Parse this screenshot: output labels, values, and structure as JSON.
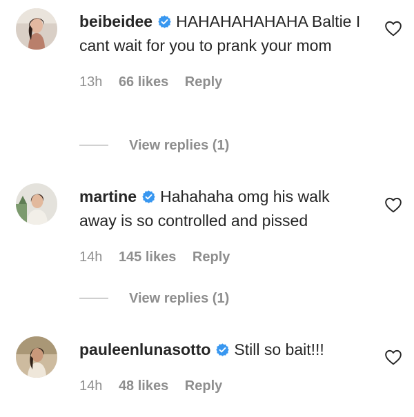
{
  "comments": [
    {
      "username": "beibeidee",
      "verified": true,
      "text": "HAHAHAHAHAHA Baltie I cant wait for you to prank your mom",
      "time": "13h",
      "likes": "66 likes",
      "reply": "Reply",
      "view_replies": "View replies (1)"
    },
    {
      "username": "martine",
      "verified": true,
      "text": "Hahahaha omg his walk away is so controlled and pissed",
      "time": "14h",
      "likes": "145 likes",
      "reply": "Reply",
      "view_replies": "View replies (1)"
    },
    {
      "username": "pauleenlunasotto",
      "verified": true,
      "text": "Still so bait!!!",
      "time": "14h",
      "likes": "48 likes",
      "reply": "Reply"
    }
  ],
  "colors": {
    "verified_badge": "#3897f0",
    "primary_text": "#262626",
    "secondary_text": "#8e8e8e",
    "background": "#ffffff"
  },
  "icons": {
    "like": "heart-outline-icon",
    "verified": "verified-badge-icon"
  }
}
